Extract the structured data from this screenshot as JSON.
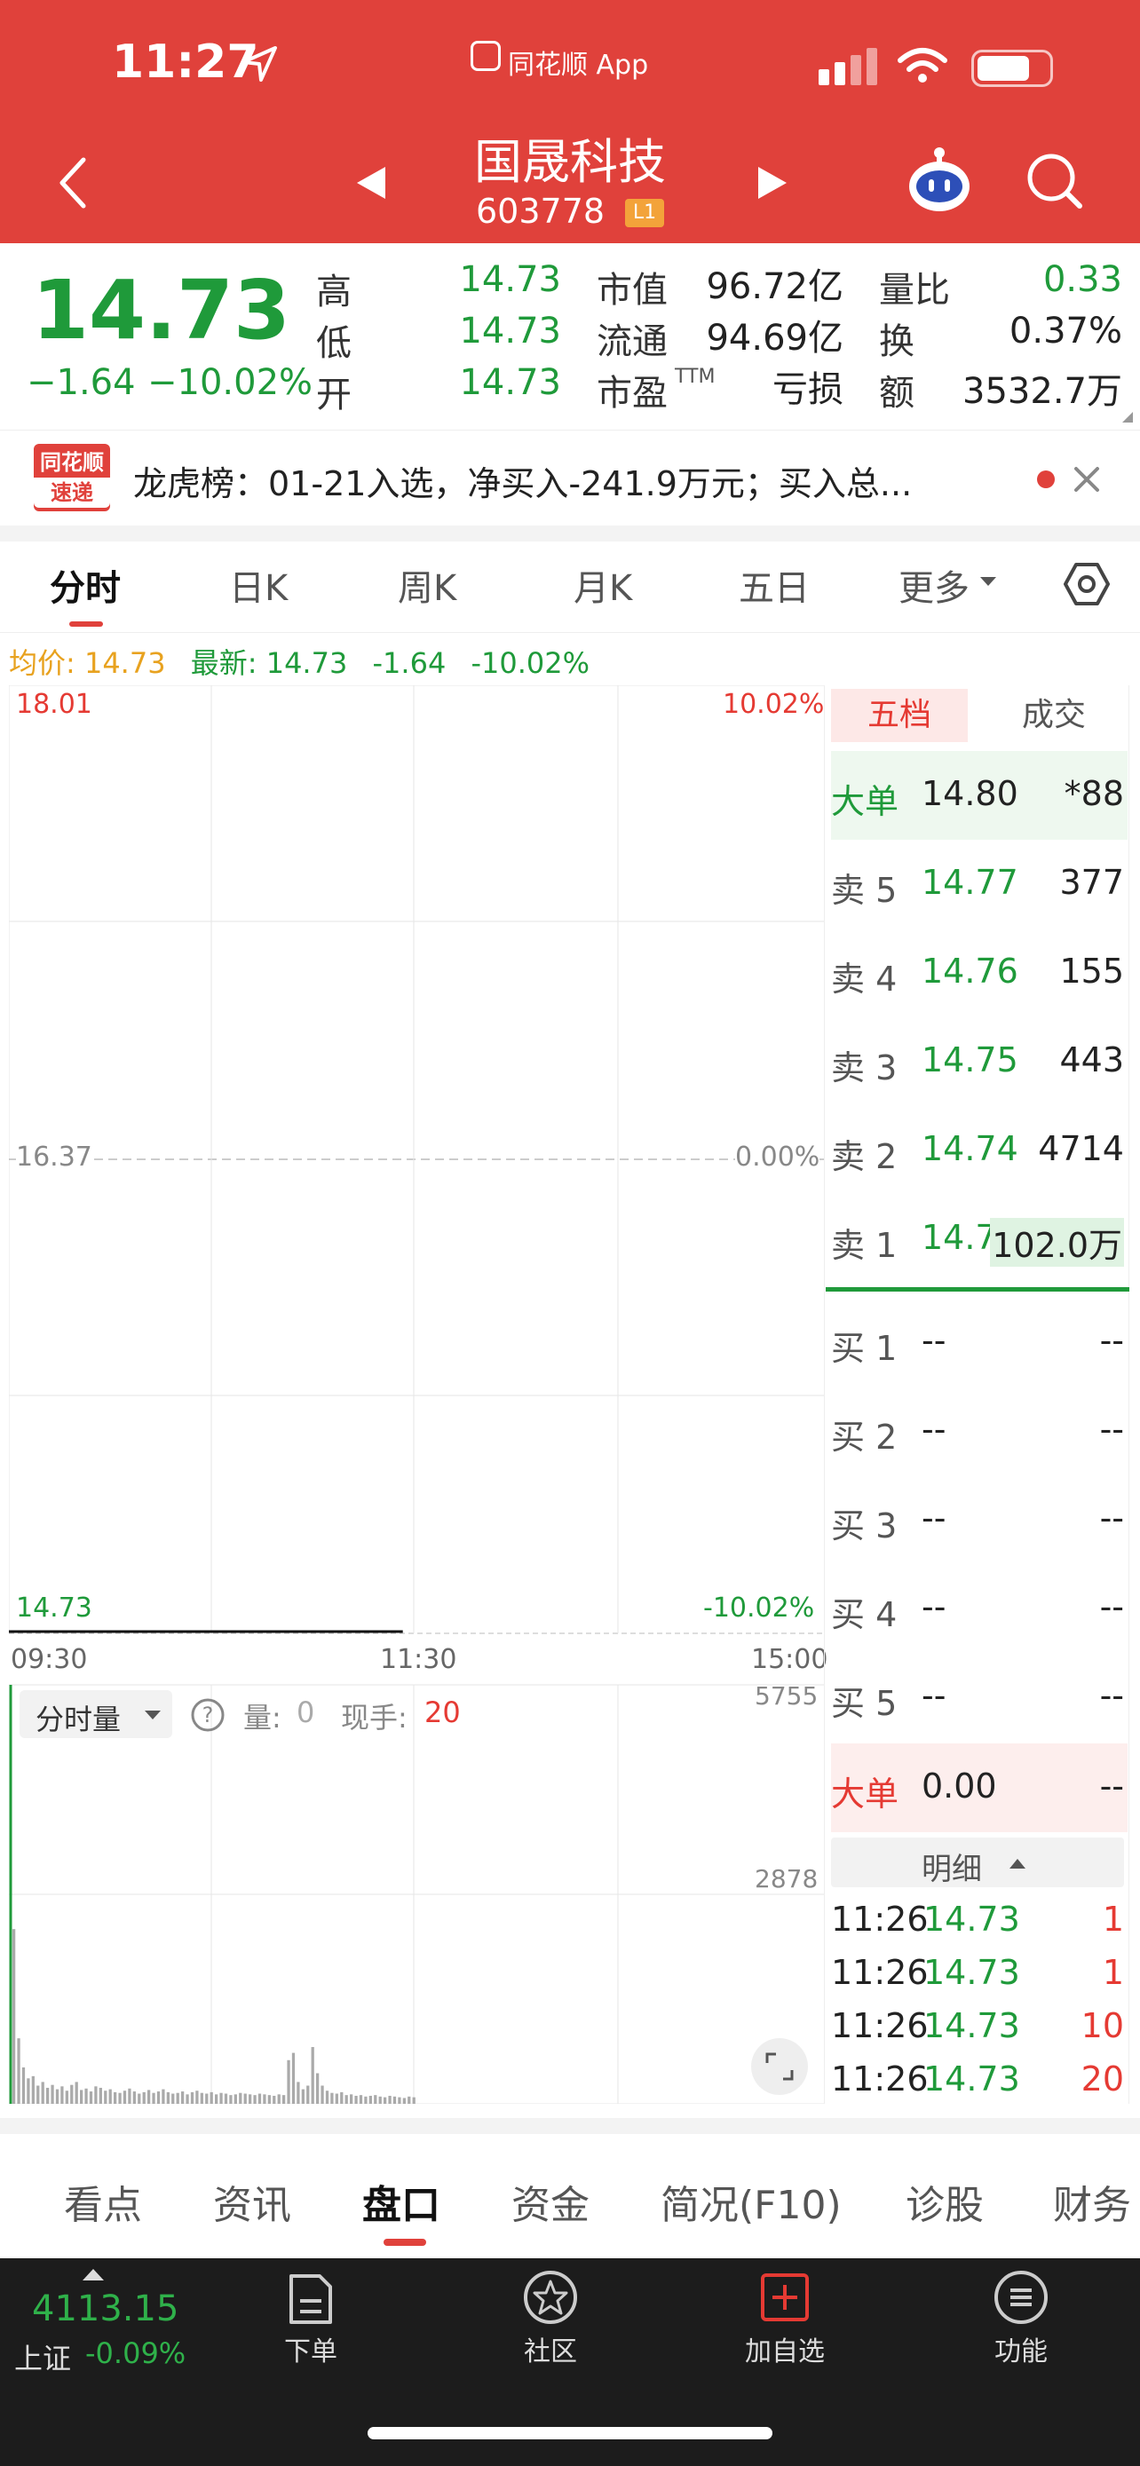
{
  "status_bar": {
    "time": "11:27",
    "app_source": "同花顺 App"
  },
  "header": {
    "stock_name": "国晟科技",
    "stock_code": "603778",
    "level_badge": "L1"
  },
  "quote": {
    "price": "14.73",
    "change": "−1.64",
    "change_pct": "−10.02%",
    "stats": [
      {
        "label": "高",
        "value": "14.73"
      },
      {
        "label": "低",
        "value": "14.73"
      },
      {
        "label": "开",
        "value": "14.73"
      },
      {
        "label": "市值",
        "value": "96.72亿"
      },
      {
        "label": "流通",
        "value": "94.69亿"
      },
      {
        "label": "市盈",
        "sup": "TTM",
        "value": "亏损"
      },
      {
        "label": "量比",
        "value": "0.33"
      },
      {
        "label": "换",
        "value": "0.37%"
      },
      {
        "label": "额",
        "value": "3532.7万"
      }
    ]
  },
  "news": {
    "badge_line1": "同花顺",
    "badge_line2": "速递",
    "text": "龙虎榜：01-21入选，净买入-241.9万元；买入总..."
  },
  "chart_tabs": [
    "分时",
    "日K",
    "周K",
    "月K",
    "五日",
    "更多"
  ],
  "info_line": {
    "avg_label": "均价: 14.73",
    "latest_label": "最新: 14.73",
    "chg": "-1.64",
    "pct": "-10.02%"
  },
  "chart_data": {
    "type": "line",
    "y_left_top": "18.01",
    "y_left_mid": "16.37",
    "y_left_bottom": "14.73",
    "y_right_top": "10.02%",
    "y_right_mid": "0.00%",
    "y_right_bottom": "-10.02%",
    "x_labels": [
      "09:30",
      "11:30",
      "15:00"
    ],
    "series": [
      {
        "x": [
          "09:30",
          "11:26"
        ],
        "values": [
          14.73,
          14.73
        ]
      }
    ],
    "ylim": [
      14.73,
      18.01
    ],
    "volume": {
      "selector_label": "分时量",
      "vol_label": "量:",
      "vol_value": "0",
      "hand_label": "现手:",
      "hand_value": "20",
      "y_top": "5755",
      "y_mid": "2878",
      "ylim": [
        0,
        5755
      ],
      "bars": [
        2400,
        900,
        500,
        350,
        380,
        250,
        300,
        220,
        260,
        200,
        240,
        180,
        260,
        300,
        190,
        210,
        170,
        240,
        220,
        180,
        200,
        160,
        150,
        180,
        210,
        170,
        140,
        160,
        190,
        150,
        170,
        200,
        160,
        140,
        150,
        170,
        130,
        160,
        180,
        150,
        140,
        160,
        130,
        150,
        140,
        120,
        130,
        150,
        140,
        130,
        120,
        140,
        130,
        120,
        110,
        130,
        120,
        600,
        700,
        300,
        200,
        250,
        780,
        420,
        250,
        180,
        150,
        140,
        160,
        120,
        130,
        110,
        120,
        100,
        110,
        120,
        100,
        90,
        110,
        100,
        90,
        80,
        100,
        90
      ]
    }
  },
  "order_book": {
    "tab_five": "五档",
    "tab_deals": "成交",
    "big_top": {
      "label": "大单",
      "price": "14.80",
      "vol": "*88"
    },
    "asks": [
      {
        "label": "卖 5",
        "price": "14.77",
        "vol": "377"
      },
      {
        "label": "卖 4",
        "price": "14.76",
        "vol": "155"
      },
      {
        "label": "卖 3",
        "price": "14.75",
        "vol": "443"
      },
      {
        "label": "卖 2",
        "price": "14.74",
        "vol": "4714"
      },
      {
        "label": "卖 1",
        "price": "14.73",
        "vol": "102.0万"
      }
    ],
    "bids": [
      {
        "label": "买 1",
        "price": "--",
        "vol": "--"
      },
      {
        "label": "买 2",
        "price": "--",
        "vol": "--"
      },
      {
        "label": "买 3",
        "price": "--",
        "vol": "--"
      },
      {
        "label": "买 4",
        "price": "--",
        "vol": "--"
      },
      {
        "label": "买 5",
        "price": "--",
        "vol": "--"
      }
    ],
    "big_bottom": {
      "label": "大单",
      "price": "0.00",
      "vol": "--"
    },
    "detail_header": "明细",
    "details": [
      {
        "time": "11:26",
        "price": "14.73",
        "vol": "1"
      },
      {
        "time": "11:26",
        "price": "14.73",
        "vol": "1"
      },
      {
        "time": "11:26",
        "price": "14.73",
        "vol": "10"
      },
      {
        "time": "11:26",
        "price": "14.73",
        "vol": "20"
      }
    ]
  },
  "bottom_tabs": [
    "看点",
    "资讯",
    "盘口",
    "资金",
    "简况(F10)",
    "诊股",
    "财务"
  ],
  "footer": {
    "index_value": "4113.15",
    "index_name": "上证",
    "index_pct": "-0.09%",
    "buttons": [
      "下单",
      "社区",
      "加自选",
      "功能"
    ]
  }
}
